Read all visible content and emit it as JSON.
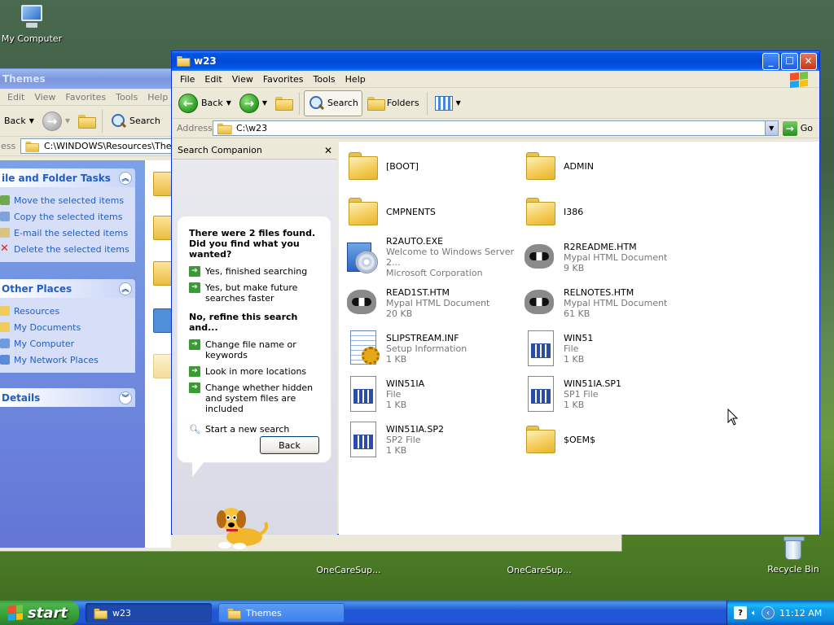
{
  "desktop": {
    "icons": [
      {
        "label": "My Computer"
      },
      {
        "label": "OneCareSup..."
      },
      {
        "label": "OneCareSup..."
      },
      {
        "label": "Recycle Bin"
      }
    ]
  },
  "back_window": {
    "title": "Themes",
    "menu": [
      "Edit",
      "View",
      "Favorites",
      "Tools",
      "Help"
    ],
    "toolbar": {
      "back": "Back",
      "search": "Search"
    },
    "address_label": "ess",
    "address": "C:\\WINDOWS\\Resources\\Themes",
    "file_tasks": {
      "title": "ile and Folder Tasks",
      "items": [
        "Move the selected items",
        "Copy the selected items",
        "E-mail the selected items",
        "Delete the selected items"
      ]
    },
    "other_places": {
      "title": "Other Places",
      "items": [
        "Resources",
        "My Documents",
        "My Computer",
        "My Network Places"
      ]
    },
    "details": {
      "title": "Details"
    }
  },
  "window": {
    "title": "w23",
    "menu": [
      "File",
      "Edit",
      "View",
      "Favorites",
      "Tools",
      "Help"
    ],
    "toolbar": {
      "back": "Back",
      "search": "Search",
      "folders": "Folders"
    },
    "address_label": "Address",
    "address": "C:\\w23",
    "go": "Go",
    "search_companion": {
      "title": "Search Companion",
      "heading": "There were 2 files found. Did you find what you wanted?",
      "option_finished": "Yes, finished searching",
      "option_faster": "Yes, but make future searches faster",
      "refine_heading": "No, refine this search and...",
      "refine_options": [
        "Change file name or keywords",
        "Look in more locations",
        "Change whether hidden and system files are included"
      ],
      "new_search": "Start a new search",
      "back_button": "Back"
    },
    "files": [
      {
        "name": "[BOOT]",
        "icon": "folder-icon",
        "type": "",
        "size": ""
      },
      {
        "name": "ADMIN",
        "icon": "folder-icon",
        "type": "",
        "size": ""
      },
      {
        "name": "CMPNENTS",
        "icon": "folder-icon",
        "type": "",
        "size": ""
      },
      {
        "name": "I386",
        "icon": "folder-icon",
        "type": "",
        "size": ""
      },
      {
        "name": "R2AUTO.EXE",
        "icon": "exe-icon",
        "type": "Welcome to Windows Server 2...",
        "size": "Microsoft Corporation"
      },
      {
        "name": "R2README.HTM",
        "icon": "raccoon-icon",
        "type": "Mypal HTML Document",
        "size": "9 KB"
      },
      {
        "name": "READ1ST.HTM",
        "icon": "raccoon-icon",
        "type": "Mypal HTML Document",
        "size": "20 KB"
      },
      {
        "name": "RELNOTES.HTM",
        "icon": "raccoon-icon",
        "type": "Mypal HTML Document",
        "size": "61 KB"
      },
      {
        "name": "SLIPSTREAM.INF",
        "icon": "inf-icon",
        "type": "Setup Information",
        "size": "1 KB"
      },
      {
        "name": "WIN51",
        "icon": "file-icon",
        "type": "File",
        "size": "1 KB"
      },
      {
        "name": "WIN51IA",
        "icon": "file-icon",
        "type": "File",
        "size": "1 KB"
      },
      {
        "name": "WIN51IA.SP1",
        "icon": "file-icon",
        "type": "SP1 File",
        "size": "1 KB"
      },
      {
        "name": "WIN51IA.SP2",
        "icon": "file-icon",
        "type": "SP2 File",
        "size": "1 KB"
      },
      {
        "name": "$OEM$",
        "icon": "folder-icon",
        "type": "",
        "size": ""
      }
    ]
  },
  "taskbar": {
    "start": "start",
    "tasks": [
      {
        "label": "w23"
      },
      {
        "label": "Themes"
      }
    ],
    "clock": "11:12 AM"
  }
}
